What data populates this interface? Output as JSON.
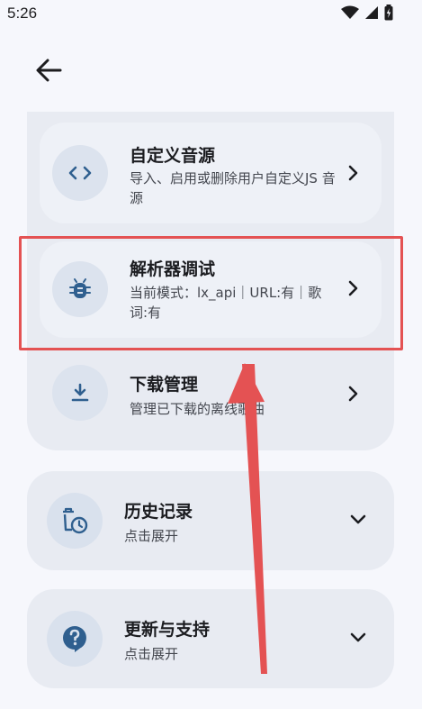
{
  "status": {
    "time": "5:26"
  },
  "group_items": [
    {
      "title": "自定义音源",
      "subtitle": "导入、启用或删除用户自定义JS 音源"
    },
    {
      "title": "解析器调试",
      "subtitle": "当前模式：lx_api｜URL:有｜歌词:有"
    },
    {
      "title": "下载管理",
      "subtitle": "管理已下载的离线歌曲"
    }
  ],
  "expandables": [
    {
      "title": "历史记录",
      "subtitle": "点击展开"
    },
    {
      "title": "更新与支持",
      "subtitle": "点击展开"
    }
  ],
  "colors": {
    "accent": "#2f5f8f",
    "highlight": "#e45253",
    "card": "#e8ebf2",
    "background": "#f6f7fc"
  },
  "icons": {
    "back": "arrow-left-icon",
    "item0": "code-icon",
    "item1": "bug-icon",
    "item2": "download-icon",
    "history": "history-icon",
    "help": "help-bubble-icon"
  }
}
